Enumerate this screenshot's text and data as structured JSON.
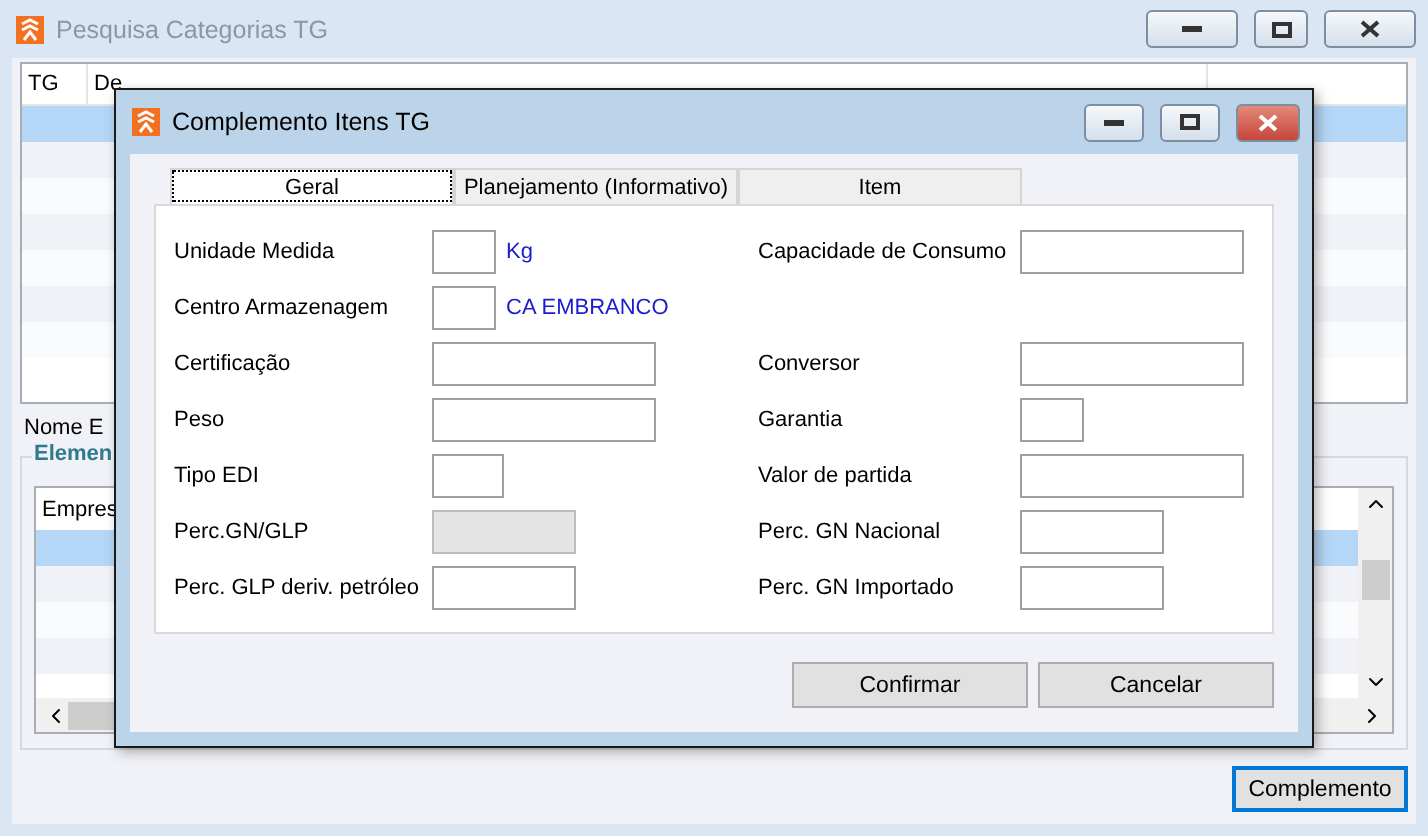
{
  "main_window": {
    "title": "Pesquisa Categorias TG",
    "columns": [
      "TG",
      "De"
    ],
    "rows": [
      {
        "selected": true
      },
      {
        "selected": false
      },
      {
        "selected": false
      },
      {
        "selected": false
      },
      {
        "selected": false
      },
      {
        "selected": false
      },
      {
        "selected": false
      }
    ],
    "name_label": "Nome E",
    "group": {
      "title": "Elemen",
      "column": "Empres",
      "rows": [
        {
          "selected": true
        },
        {
          "selected": false
        },
        {
          "selected": false
        },
        {
          "selected": false
        }
      ]
    },
    "button": {
      "label": "Complemento",
      "focused": true
    }
  },
  "dialog": {
    "title": "Complemento Itens TG",
    "tabs": [
      {
        "label": "Geral",
        "selected": true
      },
      {
        "label": "Planejamento (Informativo)",
        "selected": false
      },
      {
        "label": "Item",
        "selected": false
      }
    ],
    "rows": [
      {
        "left": {
          "label": "Unidade Medida",
          "kind": "narrow",
          "note": "Kg",
          "disabled": false
        },
        "right": {
          "label": "Capacidade de Consumo",
          "kind": "wide",
          "disabled": false
        }
      },
      {
        "left": {
          "label": "Centro Armazenagem",
          "kind": "narrow",
          "note": "CA EMBRANCO",
          "disabled": false
        }
      },
      {
        "left": {
          "label": "Certificação",
          "kind": "wide",
          "disabled": false
        },
        "right": {
          "label": "Conversor",
          "kind": "wide",
          "disabled": false
        }
      },
      {
        "left": {
          "label": "Peso",
          "kind": "wide",
          "disabled": false
        },
        "right": {
          "label": "Garantia",
          "kind": "narrow",
          "disabled": false
        }
      },
      {
        "left": {
          "label": "Tipo EDI",
          "kind": "short",
          "disabled": false
        },
        "right": {
          "label": "Valor de partida",
          "kind": "wide",
          "disabled": false
        }
      },
      {
        "left": {
          "label": "Perc.GN/GLP",
          "kind": "medium",
          "disabled": true
        },
        "right": {
          "label": "Perc. GN Nacional",
          "kind": "medium",
          "disabled": false
        }
      },
      {
        "left": {
          "label": "Perc. GLP deriv. petróleo",
          "kind": "medium",
          "disabled": false
        },
        "right": {
          "label": "Perc. GN Importado",
          "kind": "medium",
          "disabled": false
        }
      }
    ],
    "buttons": [
      "Confirmar",
      "Cancelar"
    ]
  }
}
